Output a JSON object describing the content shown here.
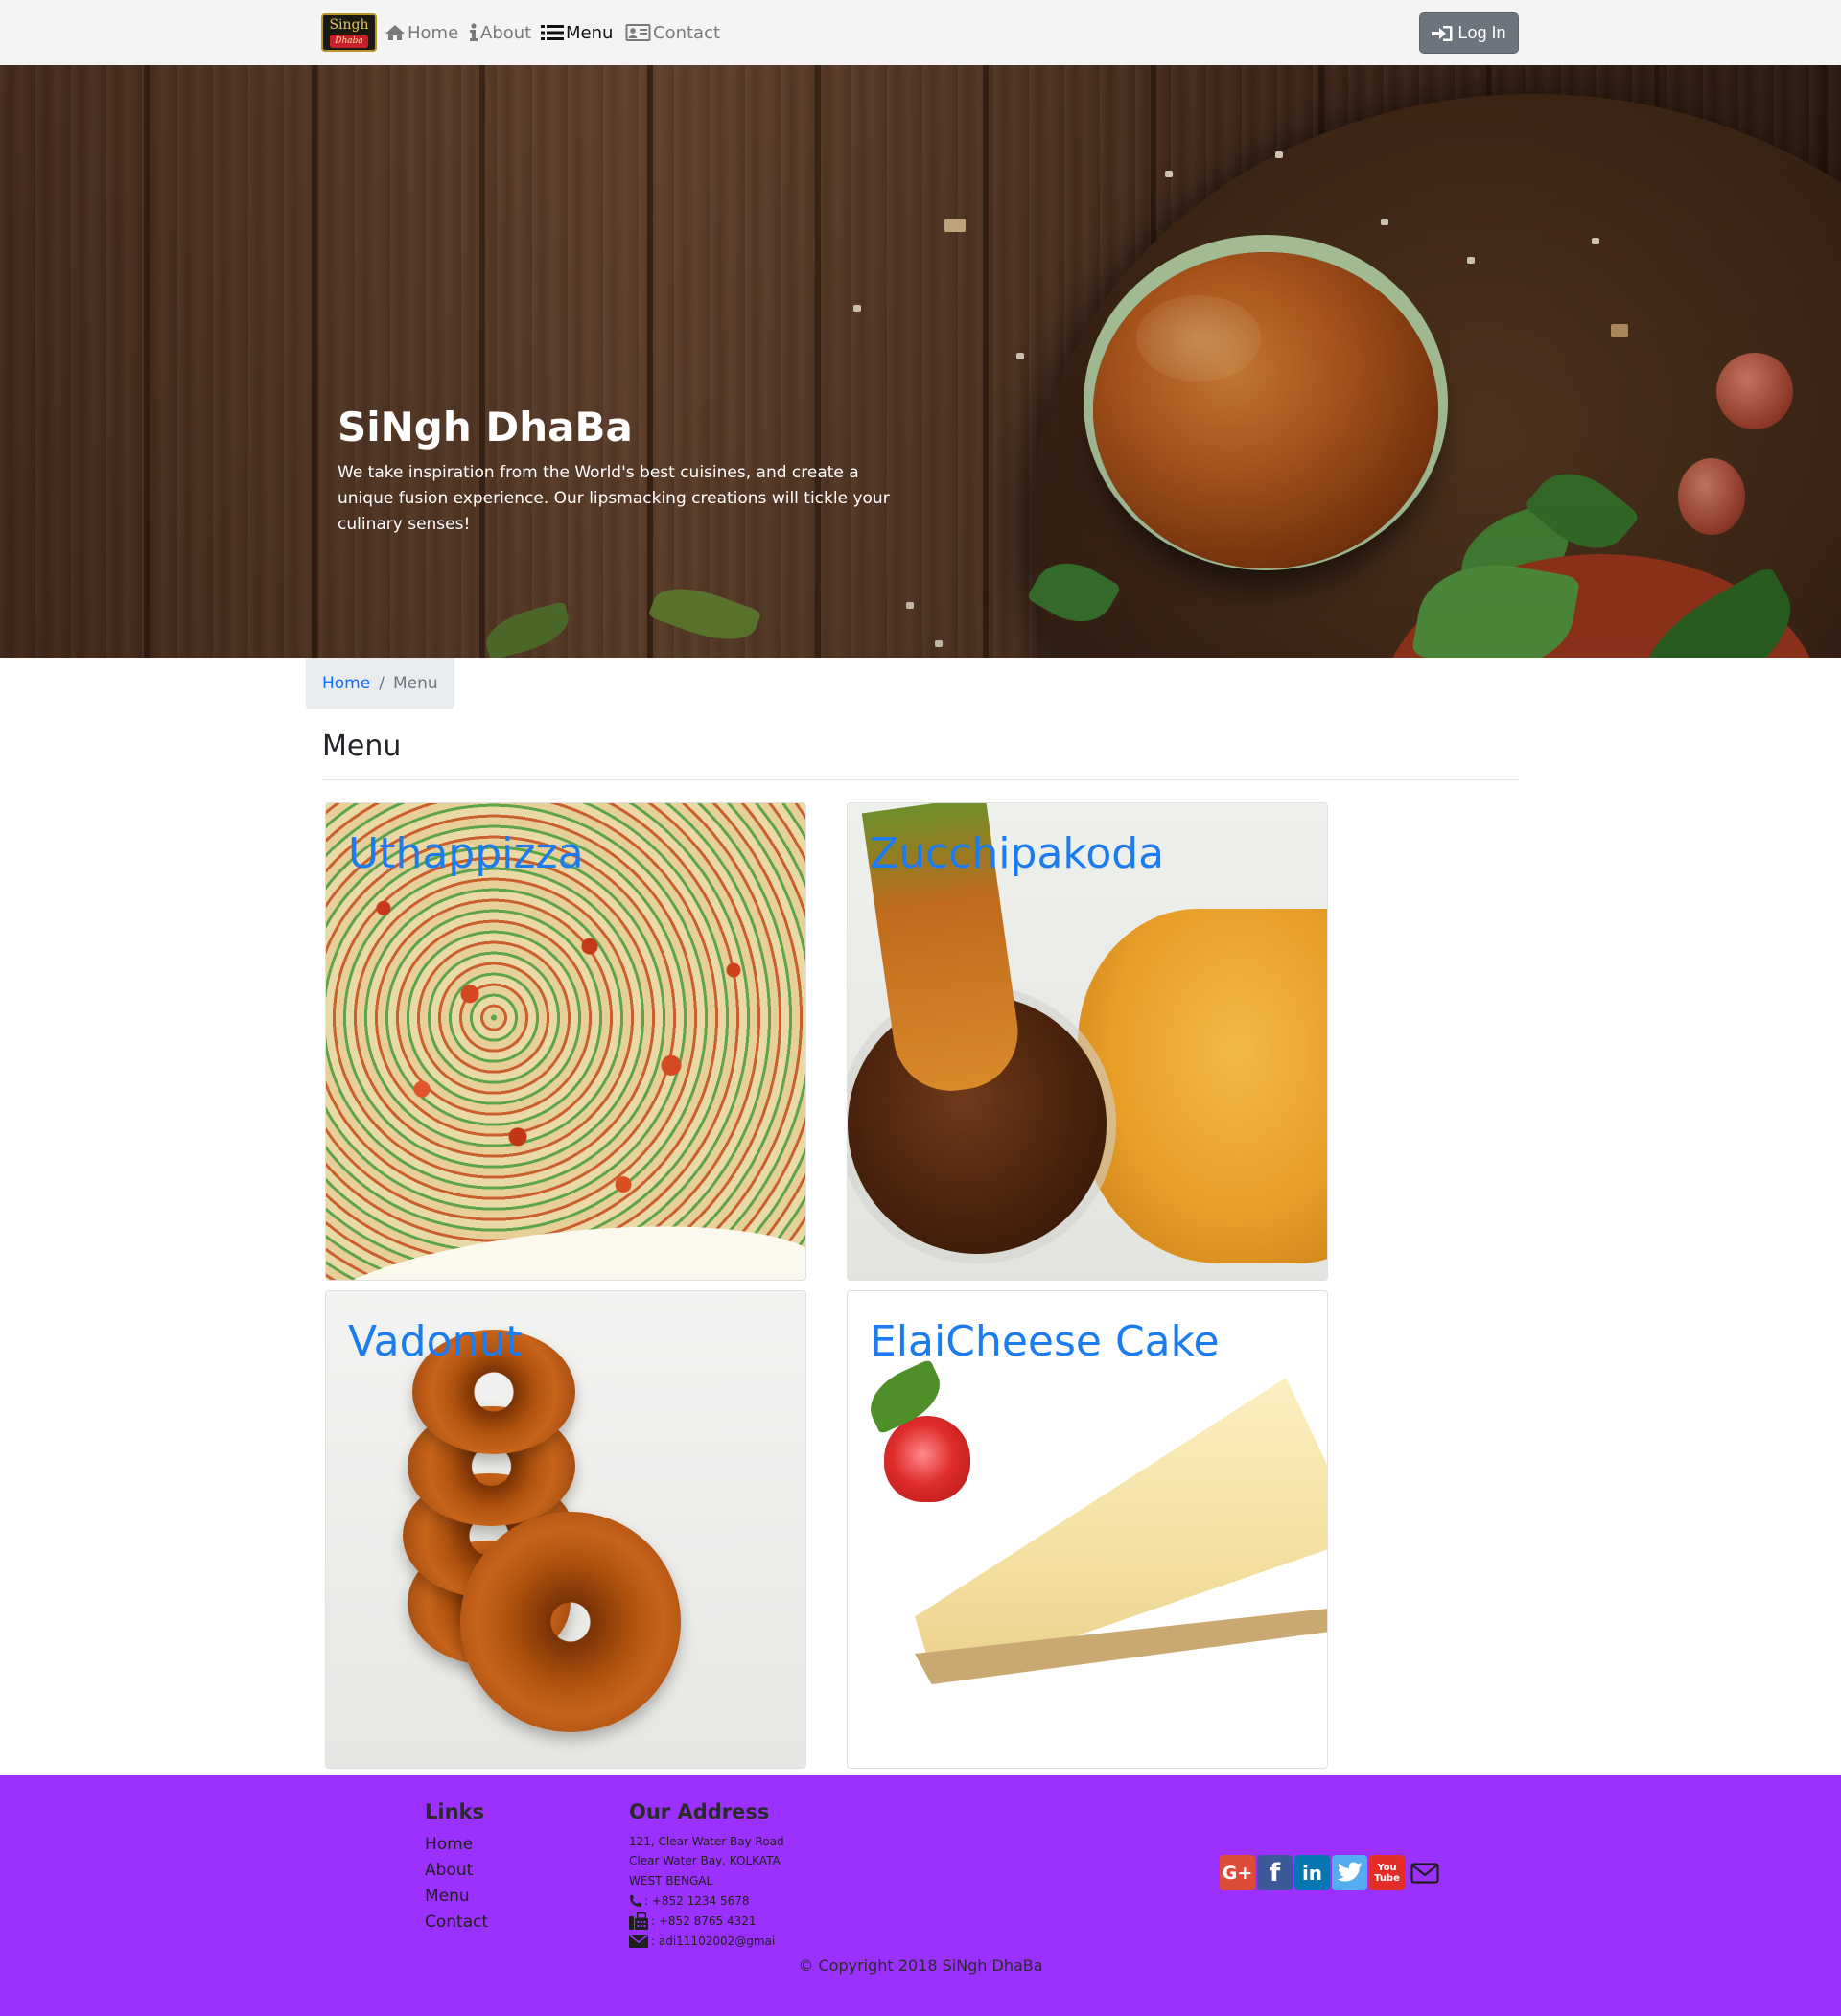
{
  "navbar": {
    "logo": {
      "line1": "Singh",
      "line2": "Dhaba"
    },
    "links": [
      {
        "label": "Home",
        "icon": "home-icon",
        "active": false
      },
      {
        "label": "About",
        "icon": "info-icon",
        "active": false
      },
      {
        "label": "Menu",
        "icon": "list-icon",
        "active": true
      },
      {
        "label": "Contact",
        "icon": "address-card-icon",
        "active": false
      }
    ],
    "login_label": "Log In",
    "login_icon": "sign-in-icon"
  },
  "hero": {
    "title": "SiNgh DhaBa",
    "description": "We take inspiration from the World's best cuisines, and create a unique fusion experience. Our lipsmacking creations will tickle your culinary senses!"
  },
  "breadcrumb": {
    "home": "Home",
    "separator": "/",
    "current": "Menu"
  },
  "page": {
    "heading": "Menu"
  },
  "menu_items": [
    {
      "name": "Uthappizza"
    },
    {
      "name": "Zucchipakoda"
    },
    {
      "name": "Vadonut"
    },
    {
      "name": "ElaiCheese Cake"
    }
  ],
  "footer": {
    "links_title": "Links",
    "links": [
      "Home",
      "About",
      "Menu",
      "Contact"
    ],
    "address_title": "Our Address",
    "address_lines": [
      "121, Clear Water Bay Road",
      "Clear Water Bay, KOLKATA",
      "WEST BENGAL"
    ],
    "phone": ": +852 1234 5678",
    "fax": ": +852 8765 4321",
    "email": ": adi11102002@gmai",
    "social": [
      "google-plus-icon",
      "facebook-icon",
      "linkedin-icon",
      "twitter-icon",
      "youtube-icon",
      "envelope-icon"
    ],
    "youtube_label": {
      "top": "You",
      "bottom": "Tube"
    },
    "copyright": "© Copyright 2018 SiNgh DhaBa"
  },
  "colors": {
    "navbar_bg": "#f4f4f4",
    "login_button": "#6c757d",
    "link_blue": "#0d6efd",
    "card_title": "#1a7cf0",
    "footer_bg": "#9b30ff"
  }
}
